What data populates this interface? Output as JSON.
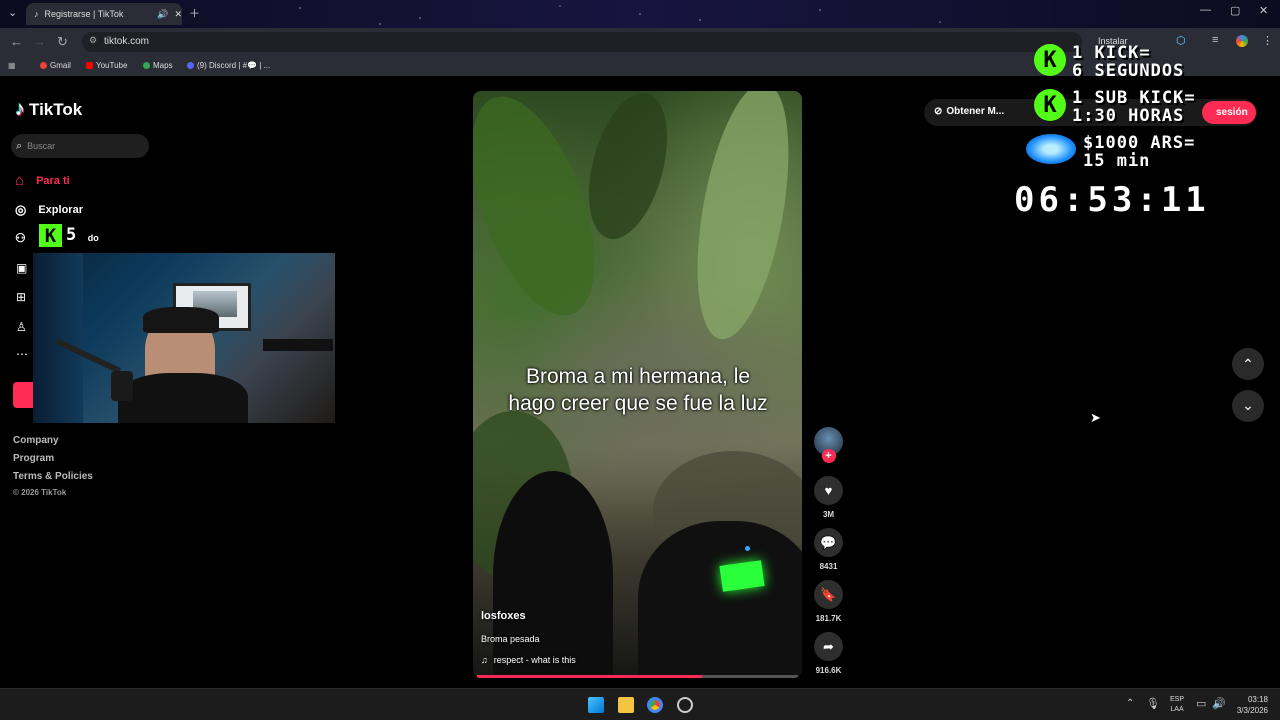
{
  "browser": {
    "tab_title": "Registrarse | TikTok",
    "url": "tiktok.com",
    "install_label": "Instalar",
    "bookmarks": [
      "Gmail",
      "YouTube",
      "Maps",
      "(9) Discord | #💬 | ..."
    ]
  },
  "tiktok": {
    "logo_text": "TikTok",
    "search_placeholder": "Buscar",
    "nav": {
      "foryou": "Para ti",
      "explore": "Explorar",
      "following_partial": "do"
    },
    "footer": {
      "company": "Company",
      "program": "Program",
      "terms": "Terms & Policies",
      "copyright": "© 2026 TikTok"
    },
    "top_right": {
      "get_app": "Obtener M...",
      "login_partial": "sesión"
    }
  },
  "video": {
    "caption": "Broma a mi hermana, le hago creer que se fue la luz",
    "author": "losfoxes",
    "description": "Broma pesada",
    "sound": "respect - what is this",
    "progress": 0.7,
    "likes": "3M",
    "comments": "8431",
    "saves": "181.7K",
    "shares": "916.6K"
  },
  "stream_overlay": {
    "kick_counter": "5",
    "line1a": "1 KICK=",
    "line1b": "6 SEGUNDOS",
    "line2a": "1 SUB KICK=",
    "line2b": "1:30 HORAS",
    "line3a": "$1000 ARS=",
    "line3b": "15 min",
    "timer": "06:53:11"
  },
  "taskbar": {
    "lang1": "ESP",
    "lang2": "LAA",
    "time": "03:18",
    "date": "3/3/2026"
  },
  "colors": {
    "tiktok_red": "#fe2c55",
    "kick_green": "#53fc18"
  }
}
